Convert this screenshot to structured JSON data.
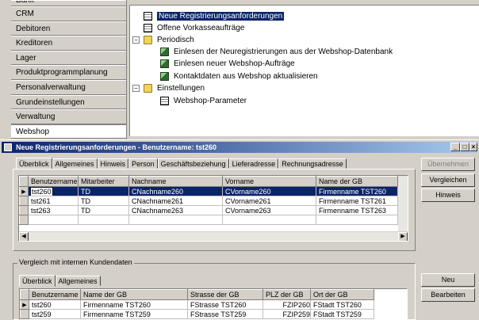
{
  "nav": {
    "items": [
      {
        "label": "Bank",
        "selected": false
      },
      {
        "label": "CRM",
        "selected": false
      },
      {
        "label": "Debitoren",
        "selected": false
      },
      {
        "label": "Kreditoren",
        "selected": false
      },
      {
        "label": "Lager",
        "selected": false
      },
      {
        "label": "Produktprogrammplanung",
        "selected": false
      },
      {
        "label": "Personalverwaltung",
        "selected": false
      },
      {
        "label": "Grundeinstellungen",
        "selected": false
      },
      {
        "label": "Verwaltung",
        "selected": false
      },
      {
        "label": "Webshop",
        "selected": true
      }
    ]
  },
  "tree": {
    "items": [
      {
        "label": "Neue Registrierungsanforderungen",
        "icon": "document-icon",
        "level": 1,
        "selected": true
      },
      {
        "label": "Offene Vorkasseaufträge",
        "icon": "document-icon",
        "level": 1
      },
      {
        "label": "Periodisch",
        "icon": "folder-icon",
        "level": 0,
        "expander": "−"
      },
      {
        "label": "Einlesen der Neuregistrierungen aus der Webshop-Datenbank",
        "icon": "run-icon",
        "level": 2
      },
      {
        "label": "Einlesen neuer Webshop-Aufträge",
        "icon": "run-icon",
        "level": 2
      },
      {
        "label": "Kontaktdaten aus Webshop aktualisieren",
        "icon": "run-icon",
        "level": 2
      },
      {
        "label": "Einstellungen",
        "icon": "folder-icon",
        "level": 0,
        "expander": "−"
      },
      {
        "label": "Webshop-Parameter",
        "icon": "document-icon",
        "level": 2
      }
    ]
  },
  "window": {
    "title": "Neue Registrierungsanforderungen - Benutzername: tst260",
    "controls": {
      "minimize": "_",
      "maximize": "□",
      "close": "×"
    }
  },
  "upper": {
    "tabs": [
      "Überblick",
      "Allgemeines",
      "Hinweis",
      "Person",
      "Geschäftsbeziehung",
      "Lieferadresse",
      "Rechnungsadresse"
    ],
    "active_tab": "Überblick",
    "columns": [
      "Benutzername",
      "Mitarbeiter",
      "Nachname",
      "Vorname",
      "Name der GB"
    ],
    "rows": [
      {
        "marker": "▶",
        "cells": [
          "tst260",
          "TD",
          "CNachname260",
          "CVorname260",
          "Firmenname TST260"
        ],
        "selected": true
      },
      {
        "marker": "",
        "cells": [
          "tst261",
          "TD",
          "CNachname261",
          "CVorname261",
          "Firmenname TST261"
        ]
      },
      {
        "marker": "",
        "cells": [
          "tst263",
          "TD",
          "CNachname263",
          "CVorname263",
          "Firmenname TST263"
        ]
      }
    ],
    "scroll_left": "◀",
    "scroll_right": "▶"
  },
  "buttons": {
    "uebernehmen": "Übernehmen",
    "vergleichen": "Vergleichen",
    "hinweis": "Hinweis",
    "neu": "Neu",
    "bearbeiten": "Bearbeiten"
  },
  "lower": {
    "group_title": "Vergleich mit internen Kundendaten",
    "tabs": [
      "Überblick",
      "Allgemeines"
    ],
    "active_tab": "Überblick",
    "columns": [
      "Benutzername",
      "Name der GB",
      "Strasse der GB",
      "PLZ der GB",
      "Ort der GB"
    ],
    "rows": [
      {
        "marker": "▶",
        "cells": [
          "tst260",
          "Firmenname TST260",
          "FStrasse TST260",
          "FZIP260",
          "FStadt TST260"
        ]
      },
      {
        "marker": "",
        "cells": [
          "tst259",
          "Firmenname TST259",
          "FStrasse TST259",
          "FZIP259",
          "FStadt TST259"
        ]
      }
    ]
  },
  "colors": {
    "selection": "#0a246a",
    "window_face": "#d4d0c8",
    "title_gradient_end": "#a6caf0"
  }
}
